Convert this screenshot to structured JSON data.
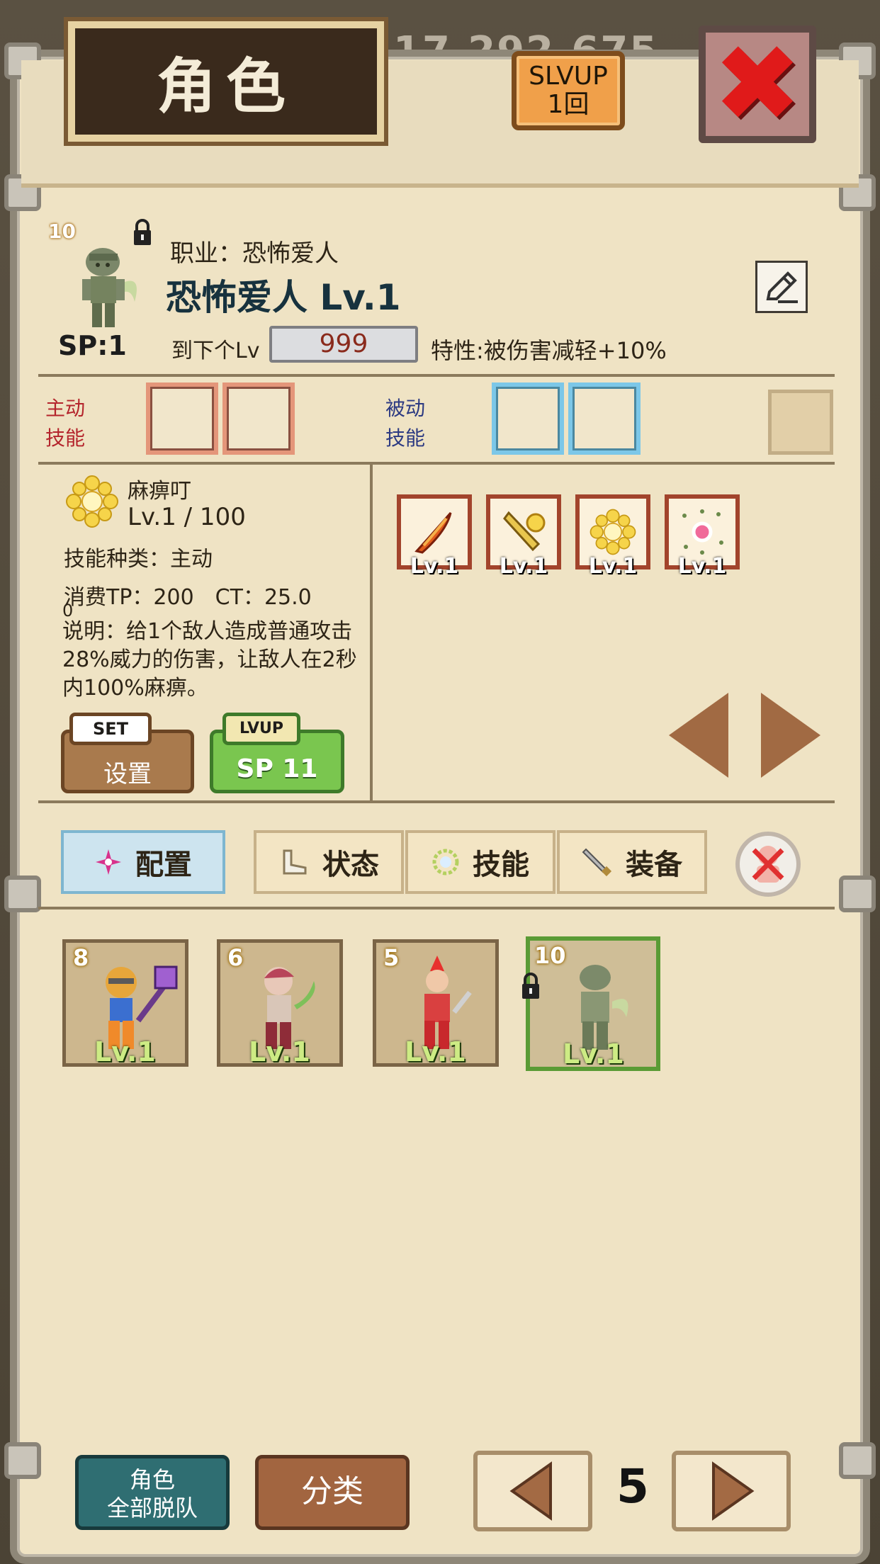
{
  "background": {
    "gold_amount": "17,292,675"
  },
  "header": {
    "title": "角色",
    "slvup_line1": "SLVUP",
    "slvup_line2": "1回"
  },
  "character": {
    "star_level": "10",
    "job_line": "职业：恐怖爱人",
    "name": "恐怖爱人 Lv.1",
    "sp": "SP:1",
    "next_lv_label": "到下个Lv",
    "next_lv_value": "999",
    "trait": "特性:被伤害减轻+10%"
  },
  "skill_slots": {
    "active_line1": "主动",
    "active_line2": "技能",
    "passive_line1": "被动",
    "passive_line2": "技能"
  },
  "skill_detail": {
    "name": "麻痹叮",
    "level": "Lv.1 / 100",
    "type": "技能种类：主动",
    "cost": "消费TP：200　CT：25.0",
    "cost_overflow": "0",
    "description": "说明：给1个敌人造成普通攻击28%威力的伤害，让敌人在2秒内100%麻痹。",
    "set_tag": "SET",
    "set_label": "设置",
    "lvup_tag": "LVUP",
    "lvup_label": "SP 11"
  },
  "learned_skills": [
    {
      "icon": "fire-claw-icon",
      "level": "Lv.1"
    },
    {
      "icon": "golden-sword-icon",
      "level": "Lv.1"
    },
    {
      "icon": "sun-flower-icon",
      "level": "Lv.1"
    },
    {
      "icon": "sparkle-orb-icon",
      "level": "Lv.1"
    }
  ],
  "tabs": [
    {
      "label": "配置",
      "icon": "burst-icon",
      "active": true
    },
    {
      "label": "状态",
      "icon": "boot-icon",
      "active": false
    },
    {
      "label": "技能",
      "icon": "gear-burst-icon",
      "active": false
    },
    {
      "label": "装备",
      "icon": "sword-icon",
      "active": false
    }
  ],
  "party": [
    {
      "stars": "8",
      "level": "Lv.1",
      "locked": false,
      "selected": false,
      "colors": {
        "hair": "#e7a63a",
        "body": "#f08a2a",
        "top": "#3b6fd0"
      }
    },
    {
      "stars": "6",
      "level": "Lv.1",
      "locked": false,
      "selected": false,
      "colors": {
        "hair": "#b8455a",
        "body": "#8e2c38",
        "top": "#d9c6b8"
      }
    },
    {
      "stars": "5",
      "level": "Lv.1",
      "locked": false,
      "selected": false,
      "colors": {
        "hair": "#e8312d",
        "body": "#c8282c",
        "top": "#d94040"
      }
    },
    {
      "stars": "10",
      "level": "Lv.1",
      "locked": true,
      "selected": true,
      "colors": {
        "hair": "#7c8a6a",
        "body": "#6b7a58",
        "top": "#8a9774"
      }
    }
  ],
  "bottom_bar": {
    "all_leave_line1": "角色",
    "all_leave_line2": "全部脱队",
    "sort_label": "分类",
    "page": "5"
  },
  "colors": {
    "parchment": "#efe3c4",
    "accent_green": "#7ac64f",
    "close_red": "#e01a1a"
  }
}
